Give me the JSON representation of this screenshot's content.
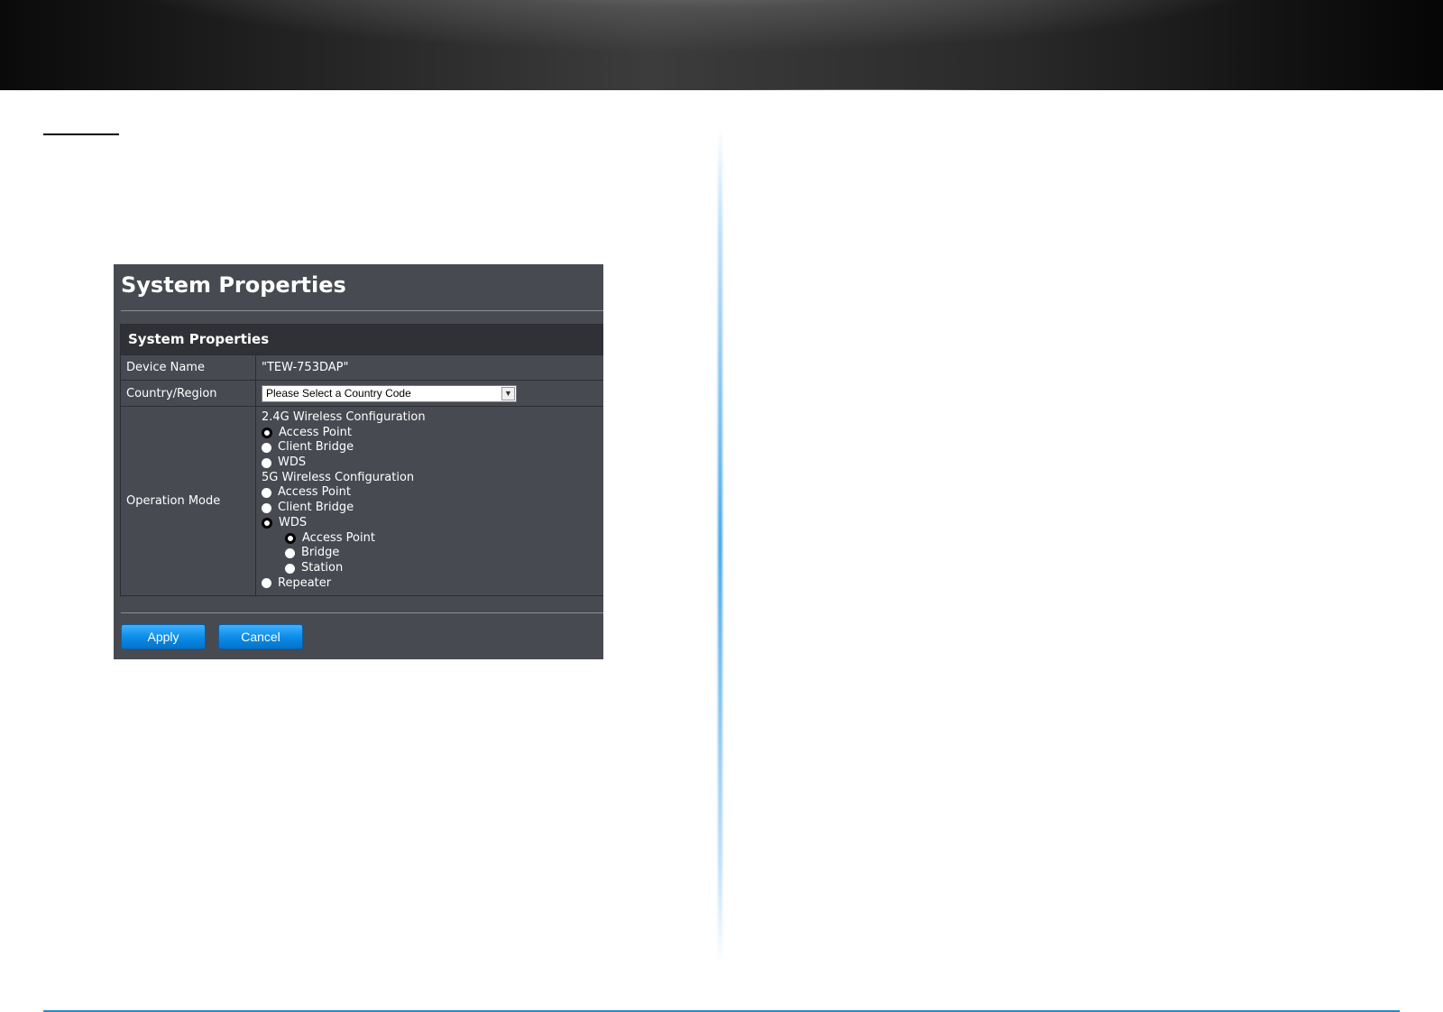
{
  "panel": {
    "title": "System Properties",
    "section_title": "System Properties",
    "device_name": {
      "label": "Device Name",
      "value": "\"TEW-753DAP\""
    },
    "country": {
      "label": "Country/Region",
      "selected": "Please Select a Country Code"
    },
    "operation_mode": {
      "label": "Operation Mode",
      "g24_heading": "2.4G Wireless Configuration",
      "g24_options": [
        {
          "label": "Access Point",
          "checked": true
        },
        {
          "label": "Client Bridge",
          "checked": false
        },
        {
          "label": "WDS",
          "checked": false
        }
      ],
      "g5_heading": "5G Wireless Configuration",
      "g5_options": [
        {
          "label": "Access Point",
          "checked": false
        },
        {
          "label": "Client Bridge",
          "checked": false
        },
        {
          "label": "WDS",
          "checked": true
        }
      ],
      "wds_sub_options": [
        {
          "label": "Access Point",
          "checked": true
        },
        {
          "label": "Bridge",
          "checked": false
        },
        {
          "label": "Station",
          "checked": false
        }
      ],
      "repeater": {
        "label": "Repeater",
        "checked": false
      }
    },
    "buttons": {
      "apply": "Apply",
      "cancel": "Cancel"
    }
  },
  "colors": {
    "panel_bg": "#474a51",
    "section_head_bg": "#2f3136",
    "button_blue": "#0a8ae6",
    "divider_blue": "#4aa8e8",
    "bottom_line": "#1d8fd8"
  }
}
